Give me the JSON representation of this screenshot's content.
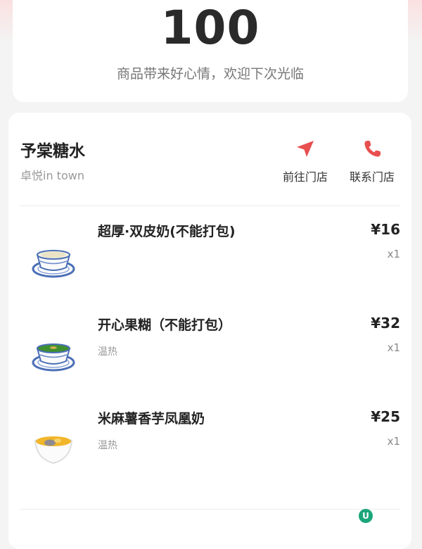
{
  "points": {
    "value": "100",
    "subtitle": "商品带来好心情，欢迎下次光临"
  },
  "store": {
    "name": "予棠糖水",
    "location": "卓悦in town",
    "actions": [
      {
        "label": "前往门店",
        "icon": "navigation-arrow-icon"
      },
      {
        "label": "联系门店",
        "icon": "phone-icon"
      }
    ]
  },
  "items": [
    {
      "name": "超厚·双皮奶(不能打包)",
      "note": "",
      "price": "¥16",
      "qty": "x1",
      "icon": "double-skin-milk-bowl-icon"
    },
    {
      "name": "开心果糊（不能打包）",
      "note": "温热",
      "price": "¥32",
      "qty": "x1",
      "icon": "pistachio-paste-bowl-icon"
    },
    {
      "name": "米麻薯香芋凤凰奶",
      "note": "温热",
      "price": "¥25",
      "qty": "x1",
      "icon": "taro-phoenix-milk-bowl-icon"
    }
  ],
  "floating_badge": {
    "letter": "U",
    "color": "#1aa67a"
  },
  "colors": {
    "accent": "#e84f4f",
    "page_bg": "#f4f4f4"
  }
}
